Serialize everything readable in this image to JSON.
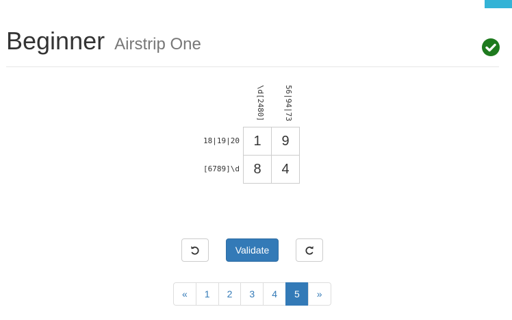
{
  "header": {
    "title": "Beginner",
    "subtitle": "Airstrip One",
    "status_icon": "check-circle-icon",
    "status_color": "#1e7a1e"
  },
  "puzzle": {
    "column_clues": [
      "\\d[2480]",
      "56|94|73"
    ],
    "row_clues": [
      "18|19|20",
      "[6789]\\d"
    ],
    "cells": [
      [
        "1",
        "9"
      ],
      [
        "8",
        "4"
      ]
    ]
  },
  "controls": {
    "undo_icon": "undo-icon",
    "validate_label": "Validate",
    "redo_icon": "redo-icon"
  },
  "pagination": {
    "prev_label": "«",
    "pages": [
      "1",
      "2",
      "3",
      "4",
      "5"
    ],
    "active_page": "5",
    "next_label": "»"
  },
  "colors": {
    "accent": "#337ab7",
    "top_bar": "#34b3d6"
  }
}
